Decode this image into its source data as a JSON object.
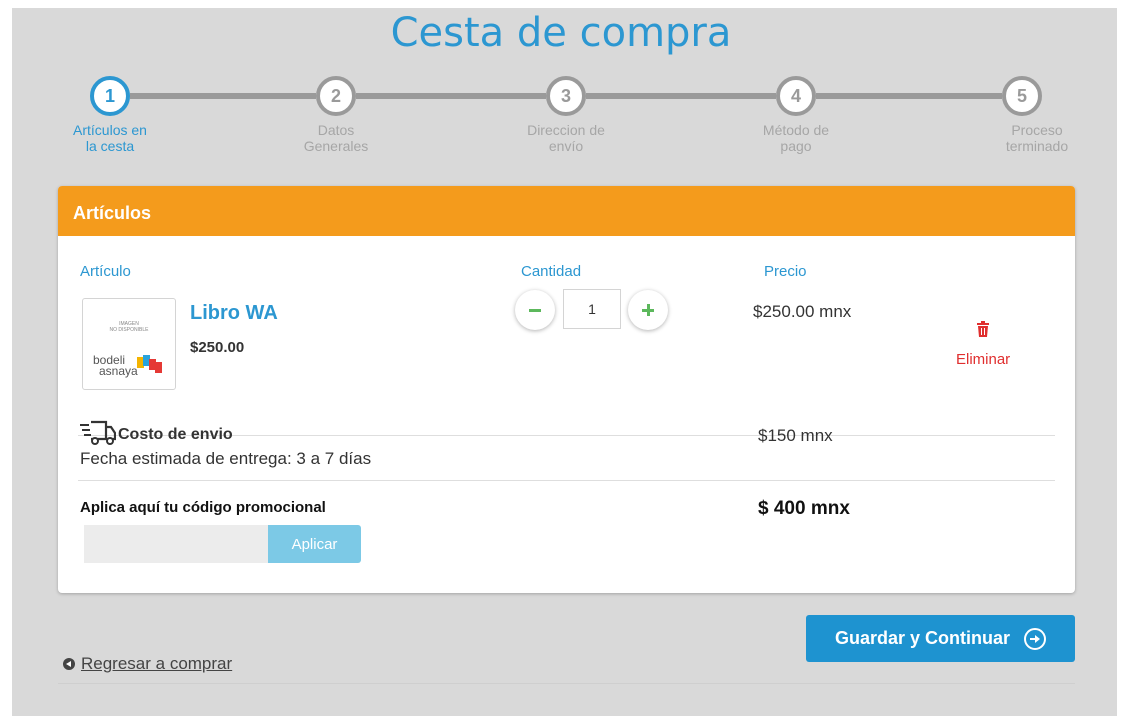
{
  "page": {
    "title": "Cesta de compra"
  },
  "steps": [
    {
      "number": "1",
      "label_line1": "Artículos en",
      "label_line2": "la cesta",
      "active": true
    },
    {
      "number": "2",
      "label_line1": "Datos",
      "label_line2": "Generales",
      "active": false
    },
    {
      "number": "3",
      "label_line1": "Direccion de",
      "label_line2": "envío",
      "active": false
    },
    {
      "number": "4",
      "label_line1": "Método de",
      "label_line2": "pago",
      "active": false
    },
    {
      "number": "5",
      "label_line1": "Proceso",
      "label_line2": "terminado",
      "active": false
    }
  ],
  "cart": {
    "header": "Artículos",
    "columns": {
      "item": "Artículo",
      "quantity": "Cantidad",
      "price": "Precio"
    },
    "item": {
      "name": "Libro WA",
      "unit_price": "$250.00",
      "quantity": "1",
      "row_price": "$250.00 mnx",
      "remove_label": "Eliminar",
      "thumb_text_line1": "IMAGEN",
      "thumb_text_line2": "NO DISPONIBLE",
      "thumb_brand_line1": "bodeli",
      "thumb_brand_line2": "asnaya"
    },
    "shipping": {
      "title": "Costo de envio",
      "estimate": "Fecha estimada de entrega: 3 a 7 días",
      "price": "$150 mnx"
    },
    "promo": {
      "label": "Aplica aquí tu código promocional",
      "placeholder": "",
      "value": "",
      "apply_label": "Aplicar"
    },
    "total": "$ 400 mnx"
  },
  "actions": {
    "back_label": "Regresar a comprar",
    "save_label": "Guardar y Continuar"
  },
  "colors": {
    "accent": "#2c97d1",
    "header": "#f49b1c",
    "qty_icon": "#5cb85c",
    "remove": "#e02f2f"
  }
}
